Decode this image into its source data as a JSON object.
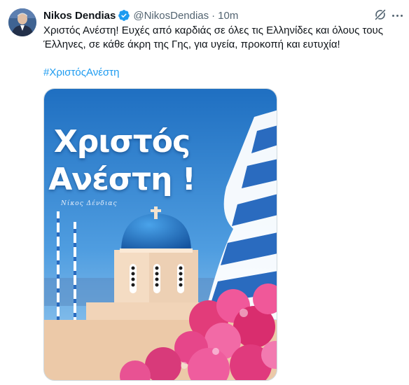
{
  "author": {
    "name": "Nikos Dendias",
    "handle": "@NikosDendias",
    "separator": "·",
    "time": "10m",
    "verified": true
  },
  "tweet": {
    "line1": "Χριστός Ανέστη! Ευχές από καρδιάς σε όλες τις Ελληνίδες και όλους τους",
    "line2": "Έλληνες, σε κάθε άκρη της Γης, για υγεία, προκοπή και ευτυχία!",
    "hashtag": "#ΧριστόςΑνέστη"
  },
  "media": {
    "title_line1": "Χριστός",
    "title_line2": "Ανέστη !",
    "signature": "Νίκος Δένδιας"
  },
  "icons": {
    "verified": "verified-badge-icon",
    "grok": "grok-icon",
    "more": "more-options-icon"
  },
  "colors": {
    "link": "#1d9bf0",
    "secondary_text": "#536471",
    "verified": "#1d9bf0"
  }
}
